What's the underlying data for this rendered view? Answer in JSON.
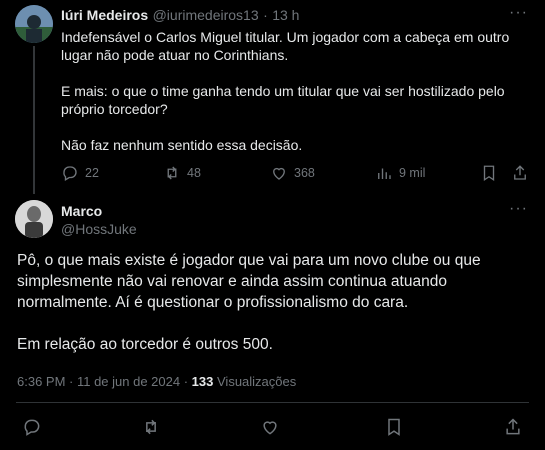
{
  "reply_tweet": {
    "author_name": "Iúri Medeiros",
    "handle": "@iurimedeiros13",
    "separator": "·",
    "time": "13 h",
    "paragraphs": [
      "Indefensável o Carlos Miguel titular. Um jogador com a cabeça em outro lugar não pode atuar no Corinthians.",
      "E mais: o que o time ganha tendo um titular que vai ser hostilizado pelo próprio torcedor?",
      "Não faz nenhum sentido essa decisão."
    ],
    "actions": {
      "replies": "22",
      "reposts": "48",
      "likes": "368",
      "views": "9 mil"
    }
  },
  "main_tweet": {
    "author_name": "Marco",
    "handle": "@HossJuke",
    "paragraphs": [
      "Pô, o que mais existe é jogador que vai para um novo clube ou que simplesmente não vai renovar e ainda assim continua atuando normalmente. Aí é questionar o profissionalismo do cara.",
      "Em relação ao torcedor é outros 500."
    ],
    "timestamp": "6:36 PM · 11 de jun de 2024 ·",
    "views_count": "133",
    "views_label": "Visualizações"
  },
  "icons": [
    "more-icon",
    "reply-icon",
    "repost-icon",
    "like-icon",
    "views-icon",
    "bookmark-icon",
    "share-icon"
  ],
  "colors": {
    "background": "#000000",
    "text": "#e7e9ea",
    "muted": "#71767b",
    "divider": "#2f3336"
  }
}
